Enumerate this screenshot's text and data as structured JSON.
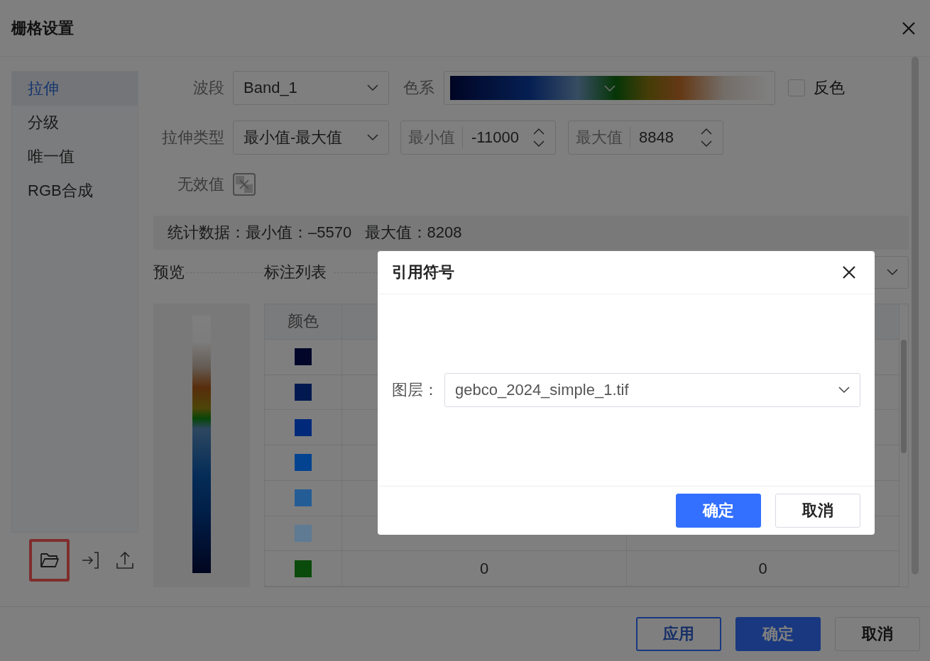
{
  "window": {
    "title": "栅格设置"
  },
  "sidebar": {
    "items": [
      {
        "label": "拉伸",
        "selected": true
      },
      {
        "label": "分级",
        "selected": false
      },
      {
        "label": "唯一值",
        "selected": false
      },
      {
        "label": "RGB合成",
        "selected": false
      }
    ],
    "tools": [
      {
        "kind": "open",
        "highlighted": true
      },
      {
        "kind": "import",
        "highlighted": false
      },
      {
        "kind": "export",
        "highlighted": false
      }
    ]
  },
  "form": {
    "band": {
      "label": "波段",
      "value": "Band_1"
    },
    "color_ramp": {
      "label": "色系"
    },
    "invert": {
      "label": "反色",
      "checked": false
    },
    "stretch_type": {
      "label": "拉伸类型",
      "value": "最小值-最大值"
    },
    "min": {
      "label": "最小值",
      "value": "-11000"
    },
    "max": {
      "label": "最大值",
      "value": "8848"
    },
    "nodata": {
      "label": "无效值"
    }
  },
  "stats": "统计数据：最小值：–5570   最大值：8208",
  "preview": {
    "label": "预览"
  },
  "legend": {
    "label": "标注列表",
    "columns": [
      "颜色"
    ],
    "rows": [
      {
        "color": "#02072a",
        "values": []
      },
      {
        "color": "#00194f",
        "values": []
      },
      {
        "color": "#00297a",
        "values": []
      },
      {
        "color": "#03438f",
        "values": []
      },
      {
        "color": "#245d96",
        "values": []
      },
      {
        "color": "#5f7a93",
        "values": []
      },
      {
        "color": "#0a4a0a",
        "values": [
          "0",
          "0"
        ]
      }
    ]
  },
  "footer_buttons": [
    {
      "label": "应用",
      "kind": "secondary"
    },
    {
      "label": "确定",
      "kind": "primary"
    },
    {
      "label": "取消",
      "kind": "default"
    }
  ],
  "modal": {
    "title": "引用符号",
    "layer": {
      "label": "图层：",
      "value": "gebco_2024_simple_1.tif"
    },
    "buttons": [
      {
        "label": "确定",
        "kind": "primary"
      },
      {
        "label": "取消",
        "kind": "default"
      }
    ]
  }
}
